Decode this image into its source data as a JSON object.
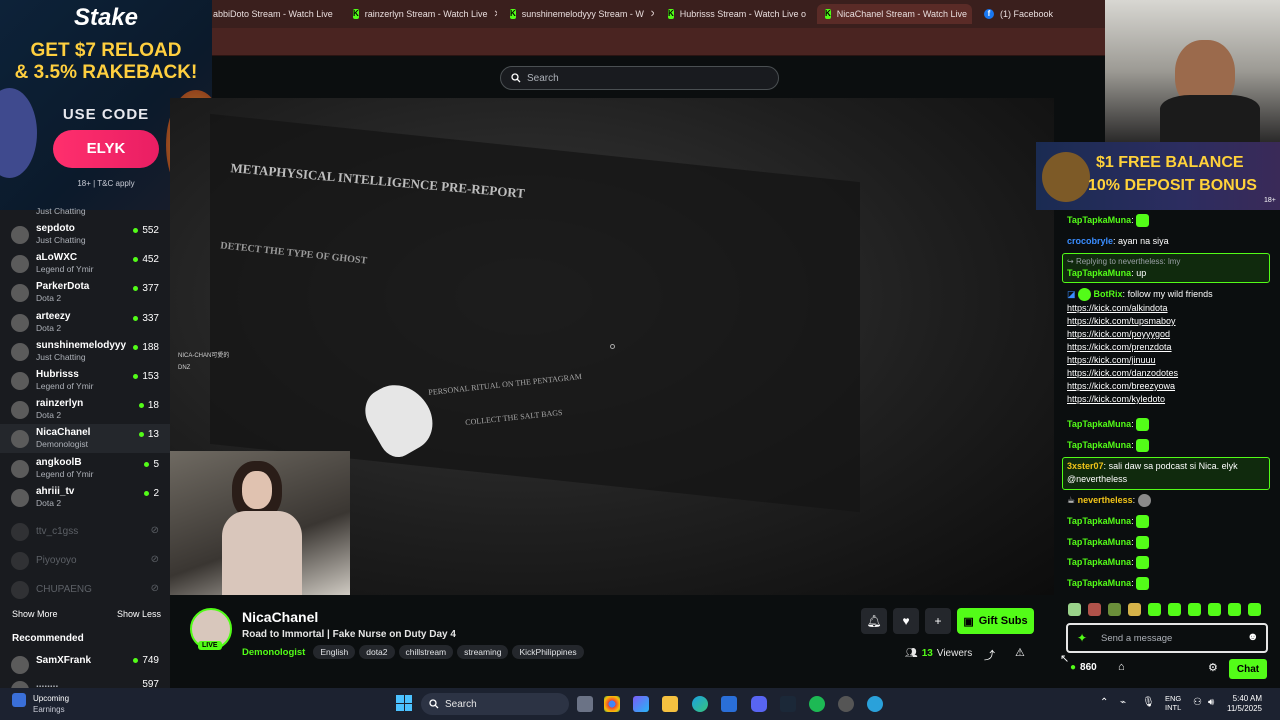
{
  "browser": {
    "tabs": [
      {
        "label": "abbiDoto Stream - Watch Live",
        "icon": "kick-icon"
      },
      {
        "label": "rainzerlyn Stream - Watch Live",
        "icon": "kick-icon"
      },
      {
        "label": "sunshinemelodyyy Stream - W",
        "icon": "kick-icon"
      },
      {
        "label": "Hubrisss Stream - Watch Live o",
        "icon": "kick-icon"
      },
      {
        "label": "NicaChanel Stream - Watch Live",
        "icon": "kick-icon",
        "active": true
      },
      {
        "label": "(1) Facebook",
        "icon": "facebook-icon"
      }
    ]
  },
  "header": {
    "search_placeholder": "Search"
  },
  "stake_ad": {
    "brand": "Stake",
    "headline1": "GET $7 RELOAD",
    "headline2": "& 3.5% RAKEBACK!",
    "use_code": "USE CODE",
    "code": "ELYK",
    "terms": "18+ | T&C apply"
  },
  "sidebar": {
    "partial_top": "Just Chatting",
    "channels": [
      {
        "name": "sepdoto",
        "category": "Just Chatting",
        "viewers": "552"
      },
      {
        "name": "aLoWXC",
        "category": "Legend of Ymir",
        "viewers": "452"
      },
      {
        "name": "ParkerDota",
        "category": "Dota 2",
        "viewers": "377"
      },
      {
        "name": "arteezy",
        "category": "Dota 2",
        "viewers": "337"
      },
      {
        "name": "sunshinemelodyyy",
        "category": "Just Chatting",
        "viewers": "188"
      },
      {
        "name": "Hubrisss",
        "category": "Legend of Ymir",
        "viewers": "153"
      },
      {
        "name": "rainzerlyn",
        "category": "Dota 2",
        "viewers": "18"
      },
      {
        "name": "NicaChanel",
        "category": "Demonologist",
        "viewers": "13",
        "selected": true
      },
      {
        "name": "angkoolB",
        "category": "Legend of Ymir",
        "viewers": "5"
      },
      {
        "name": "ahriii_tv",
        "category": "Dota 2",
        "viewers": "2"
      }
    ],
    "offline": [
      "ttv_c1gss",
      "Piyoyoyo",
      "CHUPAENG"
    ],
    "show_more": "Show More",
    "show_less": "Show Less",
    "recommended_title": "Recommended",
    "recommended": [
      {
        "name": "SamXFrank",
        "viewers": "749"
      },
      {
        "name": "........",
        "viewers": "597"
      }
    ]
  },
  "video": {
    "overlay_lines": [
      "NICA-CHAN可愛的",
      "DNZ"
    ],
    "game_title": "METAPHYSICAL INTELLIGENCE PRE-REPORT",
    "game_subtitle": "DETECT THE TYPE OF GHOST",
    "game_task1": "PERSONAL RITUAL ON THE PENTAGRAM",
    "game_task2": "COLLECT THE SALT BAGS"
  },
  "streamer": {
    "name": "NicaChanel",
    "title": "Road to Immortal | Fake Nurse on Duty Day 4",
    "category": "Demonologist",
    "tags": [
      "English",
      "dota2",
      "chillstream",
      "streaming",
      "KickPhilippines"
    ],
    "live_badge": "LIVE",
    "viewers_count": "13",
    "viewers_label": "Viewers",
    "gift_subs": "Gift Subs"
  },
  "right_ad": {
    "line1": "$1 FREE BALANCE",
    "line2": "10% DEPOSIT BONUS",
    "age": "18+"
  },
  "chat": {
    "messages": [
      {
        "user": "TapTapkaMuna",
        "text": ""
      },
      {
        "user": "crocobryle",
        "text": "ayan na siya"
      },
      {
        "reply": "Replying to nevertheless: lmy",
        "user": "TapTapkaMuna",
        "text": "up"
      },
      {
        "user": "BotRix",
        "text": "follow my wild friends"
      },
      {
        "user": "TapTapkaMuna",
        "text": ""
      },
      {
        "user": "TapTapkaMuna",
        "text": ""
      },
      {
        "user": "3xster07",
        "text": "sali daw sa podcast si Nica. elyk @nevertheless"
      },
      {
        "user": "nevertheless",
        "text": ""
      },
      {
        "user": "TapTapkaMuna",
        "text": ""
      },
      {
        "user": "TapTapkaMuna",
        "text": ""
      },
      {
        "user": "TapTapkaMuna",
        "text": ""
      },
      {
        "user": "TapTapkaMuna",
        "text": ""
      }
    ],
    "links": [
      "https://kick.com/alkindota",
      "https://kick.com/tupsmaboy",
      "https://kick.com/poyyygod",
      "https://kick.com/prenzdota",
      "https://kick.com/jinuuu",
      "https://kick.com/danzodotes",
      "https://kick.com/breezyowa",
      "https://kick.com/kyledoto"
    ],
    "input_placeholder": "Send a message",
    "points": "860",
    "chat_button": "Chat"
  },
  "taskbar": {
    "upcoming_title": "Upcoming",
    "upcoming_sub": "Earnings",
    "search": "Search",
    "lang1": "ENG",
    "lang2": "INTL",
    "time": "5:40 AM",
    "date": "11/5/2025"
  },
  "colors": {
    "kick_green": "#53fc18",
    "bg": "#0b0e0f",
    "sidebar": "#191b1f",
    "tab_bar": "#3a1f1d"
  }
}
